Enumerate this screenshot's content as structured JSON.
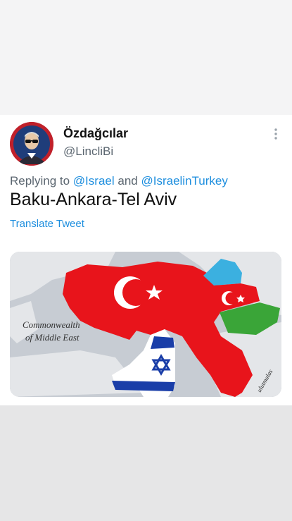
{
  "tweet": {
    "display_name": "Özdağcılar",
    "handle": "@LincliBi",
    "reply_prefix": "Replying to",
    "reply_mention_1": "@Israel",
    "reply_and": "and",
    "reply_mention_2": "@IsraelinTurkey",
    "text": "Baku-Ankara-Tel Aviv",
    "translate_label": "Translate Tweet"
  },
  "media": {
    "caption_line1": "Commonwealth",
    "caption_line2": "of Middle East",
    "signature": "ulutmalas"
  },
  "icons": {
    "more": "vertical-ellipsis-icon",
    "avatar": "user-avatar"
  },
  "colors": {
    "accent": "#1d8ede",
    "turkey_red": "#e8141b",
    "israel_blue": "#1a3ea8",
    "azer_blue": "#3bb0e0",
    "azer_green": "#3aa538"
  }
}
